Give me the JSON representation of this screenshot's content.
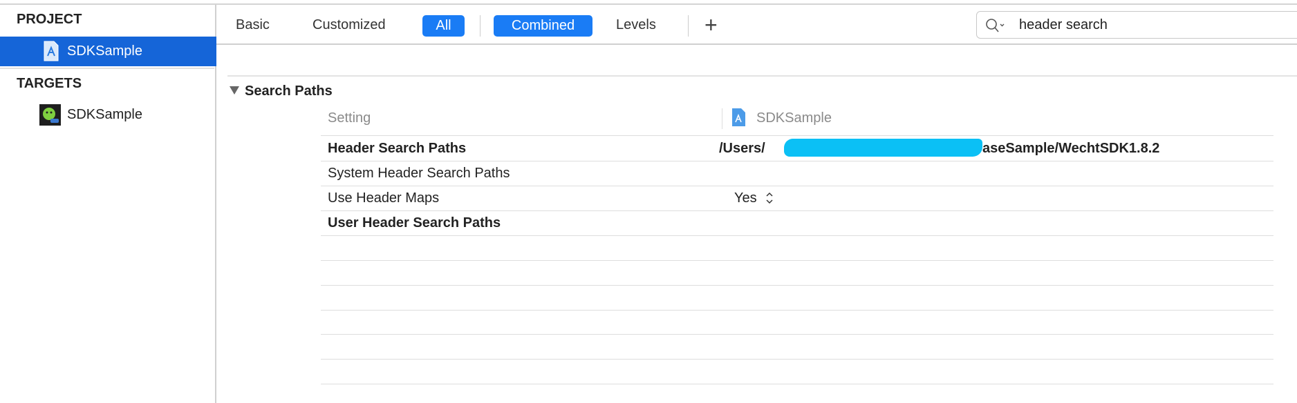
{
  "sidebar": {
    "project_header": "PROJECT",
    "project_item": "SDKSample",
    "targets_header": "TARGETS",
    "target_item": "SDKSample"
  },
  "toolbar": {
    "tabs": [
      "Basic",
      "Customized",
      "All",
      "Combined",
      "Levels"
    ],
    "add_label": "+",
    "search_value": "header search"
  },
  "section": {
    "title": "Search Paths",
    "col_setting": "Setting",
    "col_target": "SDKSample",
    "rows": [
      {
        "name": "Header Search Paths",
        "bold": true,
        "value_prefix": "/Users/",
        "value_suffix": "aseSample/WechtSDK1.8.2"
      },
      {
        "name": "System Header Search Paths",
        "bold": false
      },
      {
        "name": "Use Header Maps",
        "bold": false,
        "value": "Yes"
      },
      {
        "name": "User Header Search Paths",
        "bold": true
      }
    ]
  },
  "colors": {
    "accent": "#1a7cf5",
    "selection": "#1565d8",
    "redaction": "#0bc0f5"
  }
}
